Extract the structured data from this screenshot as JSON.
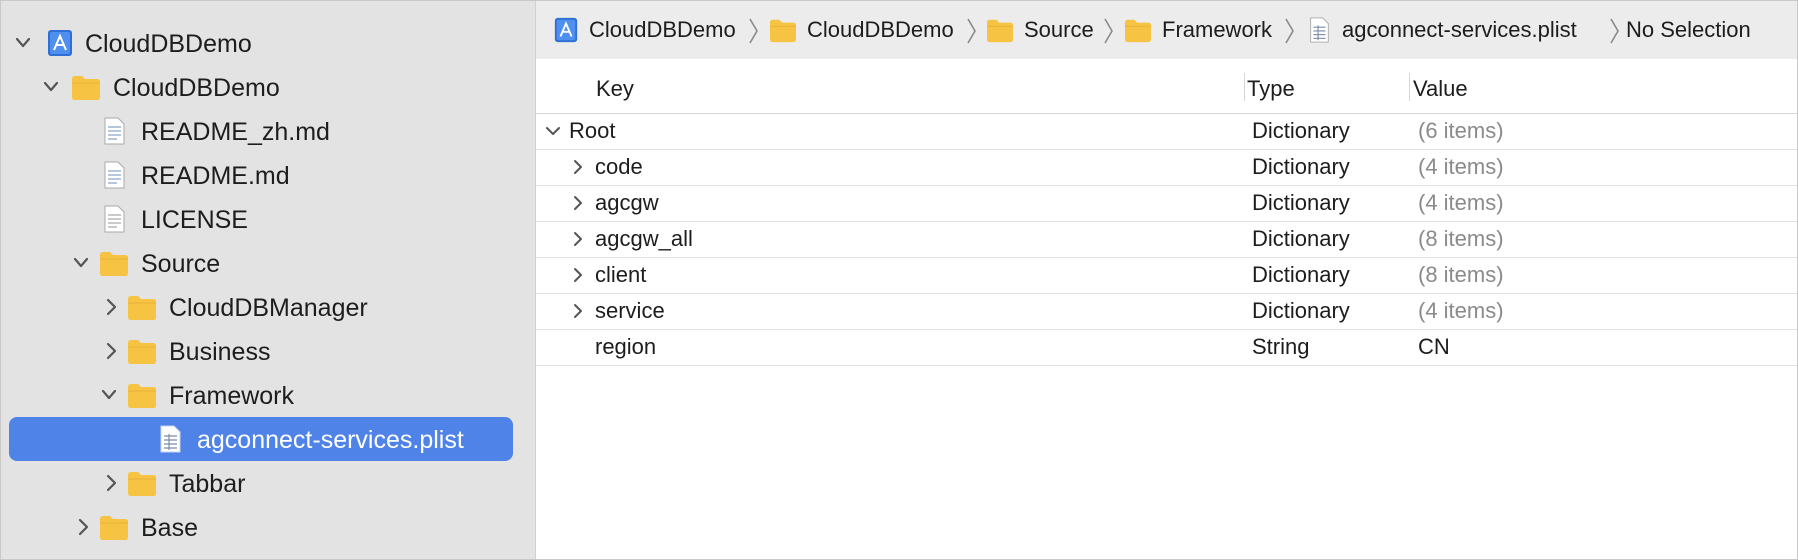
{
  "sidebar": {
    "project": "CloudDBDemo",
    "group": "CloudDBDemo",
    "files": {
      "readme_zh": "README_zh.md",
      "readme": "README.md",
      "license": "LICENSE"
    },
    "source": "Source",
    "cloud_db_manager": "CloudDBManager",
    "business": "Business",
    "framework": "Framework",
    "selected_file": "agconnect-services.plist",
    "tabbar": "Tabbar",
    "base": "Base"
  },
  "jumpbar": {
    "crumbs": [
      "CloudDBDemo",
      "CloudDBDemo",
      "Source",
      "Framework",
      "agconnect-services.plist",
      "No Selection"
    ]
  },
  "plist": {
    "headers": {
      "key": "Key",
      "type": "Type",
      "value": "Value"
    },
    "rows": [
      {
        "key": "Root",
        "type": "Dictionary",
        "value": "(6 items)"
      },
      {
        "key": "code",
        "type": "Dictionary",
        "value": "(4 items)"
      },
      {
        "key": "agcgw",
        "type": "Dictionary",
        "value": "(4 items)"
      },
      {
        "key": "agcgw_all",
        "type": "Dictionary",
        "value": "(8 items)"
      },
      {
        "key": "client",
        "type": "Dictionary",
        "value": "(8 items)"
      },
      {
        "key": "service",
        "type": "Dictionary",
        "value": "(4 items)"
      },
      {
        "key": "region",
        "type": "String",
        "value": "CN"
      }
    ]
  },
  "colors": {
    "selection": "#4f83e8",
    "folder": "#f6c342",
    "sidebar_bg": "#e3e3e3",
    "project_icon": "#2f6fd6"
  }
}
